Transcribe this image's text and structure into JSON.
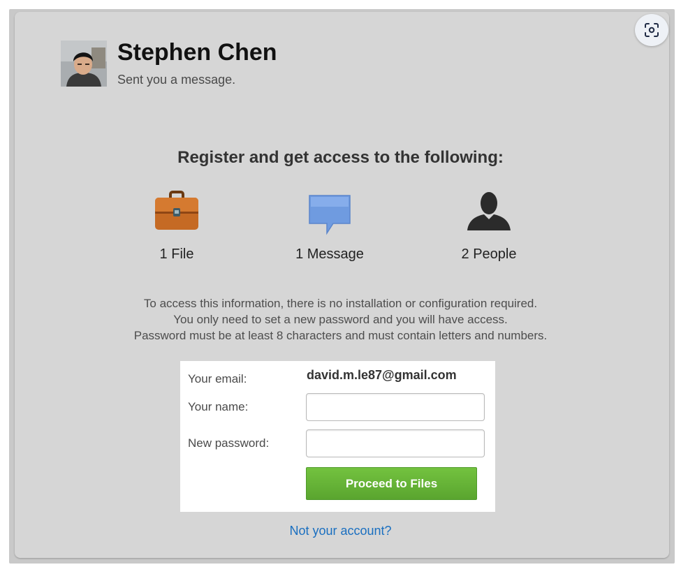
{
  "sender": {
    "name": "Stephen Chen",
    "subtitle": "Sent you a message."
  },
  "headline": "Register and get access to the following:",
  "features": [
    {
      "icon": "briefcase-icon",
      "label": "1 File"
    },
    {
      "icon": "message-bubble-icon",
      "label": "1 Message"
    },
    {
      "icon": "person-icon",
      "label": "2 People"
    }
  ],
  "info_lines": [
    "To access this information, there is no installation or configuration required.",
    "You only need to set a new password and you will have access.",
    "Password must be at least 8 characters and must contain letters and numbers."
  ],
  "form": {
    "email_label": "Your email:",
    "email_value": "david.m.le87@gmail.com",
    "name_label": "Your name:",
    "name_value": "",
    "password_label": "New password:",
    "password_value": "",
    "submit_label": "Proceed to Files"
  },
  "not_account_link": "Not your account?",
  "colors": {
    "accent_green": "#5aa52f",
    "link_blue": "#1a6fc0",
    "card_background": "#d6d6d6"
  }
}
